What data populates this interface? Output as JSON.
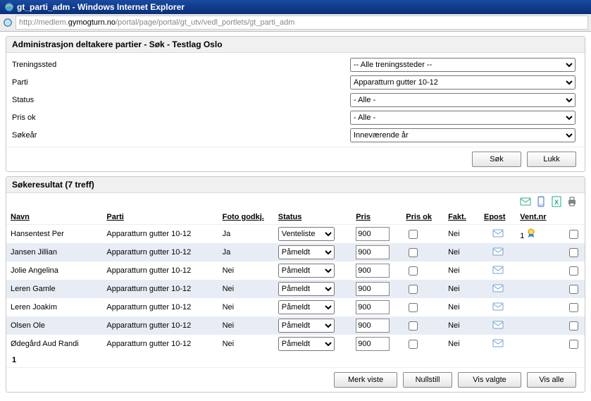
{
  "window": {
    "title": "gt_parti_adm - Windows Internet Explorer"
  },
  "address": {
    "proto": "http://",
    "host_pre": "medlem.",
    "host_bold": "gymogturn.no",
    "path": "/portal/page/portal/gt_utv/vedl_portlets/gt_parti_adm"
  },
  "panel1": {
    "header": "Administrasjon deltakere partier - Søk - Testlag Oslo",
    "labels": {
      "treningssted": "Treningssted",
      "parti": "Parti",
      "status": "Status",
      "pris_ok": "Pris ok",
      "sokeaar": "Søkeår"
    },
    "selects": {
      "treningssted": "-- Alle treningssteder --",
      "parti": "Apparatturn gutter 10-12",
      "status": "- Alle -",
      "pris_ok": "- Alle -",
      "sokeaar": "Inneværende år"
    },
    "buttons": {
      "sok": "Søk",
      "lukk": "Lukk"
    }
  },
  "panel2": {
    "header": "Søkeresultat (7 treff)",
    "columns": {
      "navn": "Navn",
      "parti": "Parti",
      "foto": "Foto godkj.",
      "status": "Status",
      "pris": "Pris",
      "pris_ok": "Pris ok",
      "fakt": "Fakt.",
      "epost": "Epost",
      "vent": "Vent.nr"
    },
    "rows": [
      {
        "navn": "Hansentest Per",
        "parti": "Apparatturn gutter 10-12",
        "foto": "Ja",
        "status": "Venteliste",
        "pris": "900",
        "fakt": "Nei",
        "vent": "1",
        "alt": false,
        "ribbon": true
      },
      {
        "navn": "Jansen Jillian",
        "parti": "Apparatturn gutter 10-12",
        "foto": "Ja",
        "status": "Påmeldt",
        "pris": "900",
        "fakt": "Nei",
        "vent": "",
        "alt": true,
        "ribbon": false
      },
      {
        "navn": "Jolie Angelina",
        "parti": "Apparatturn gutter 10-12",
        "foto": "Nei",
        "status": "Påmeldt",
        "pris": "900",
        "fakt": "Nei",
        "vent": "",
        "alt": false,
        "ribbon": false
      },
      {
        "navn": "Leren Gamle",
        "parti": "Apparatturn gutter 10-12",
        "foto": "Nei",
        "status": "Påmeldt",
        "pris": "900",
        "fakt": "Nei",
        "vent": "",
        "alt": true,
        "ribbon": false
      },
      {
        "navn": "Leren Joakim",
        "parti": "Apparatturn gutter 10-12",
        "foto": "Nei",
        "status": "Påmeldt",
        "pris": "900",
        "fakt": "Nei",
        "vent": "",
        "alt": false,
        "ribbon": false
      },
      {
        "navn": "Olsen Ole",
        "parti": "Apparatturn gutter 10-12",
        "foto": "Nei",
        "status": "Påmeldt",
        "pris": "900",
        "fakt": "Nei",
        "vent": "",
        "alt": true,
        "ribbon": false
      },
      {
        "navn": "Ødegård Aud Randi",
        "parti": "Apparatturn gutter 10-12",
        "foto": "Nei",
        "status": "Påmeldt",
        "pris": "900",
        "fakt": "Nei",
        "vent": "",
        "alt": false,
        "ribbon": false
      }
    ],
    "pager": "1",
    "buttons": {
      "merk": "Merk viste",
      "nullstill": "Nullstill",
      "vis_valgte": "Vis valgte",
      "vis_alle": "Vis alle"
    }
  },
  "colors": {
    "accent": "#1a4aa0"
  }
}
